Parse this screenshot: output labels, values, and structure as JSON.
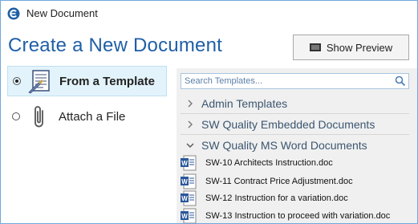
{
  "window": {
    "title": "New Document"
  },
  "header": {
    "title": "Create a New Document",
    "preview_button": "Show Preview"
  },
  "options": {
    "template": {
      "label": "From a Template",
      "selected": true
    },
    "attach": {
      "label": "Attach a File",
      "selected": false
    }
  },
  "search": {
    "placeholder": "Search Templates..."
  },
  "folders": [
    {
      "label": "Admin Templates",
      "expanded": false
    },
    {
      "label": "SW Quality Embedded Documents",
      "expanded": false
    },
    {
      "label": "SW Quality MS Word Documents",
      "expanded": true
    }
  ],
  "documents": [
    {
      "label": "SW-10 Architects Instruction.doc",
      "icon": "word-doc-icon"
    },
    {
      "label": "SW-11 Contract Price Adjustment.doc",
      "icon": "word-doc-icon"
    },
    {
      "label": "SW-12 Instruction for a variation.doc",
      "icon": "word-doc-icon"
    },
    {
      "label": "SW-13 Instruction to proceed with variation.doc",
      "icon": "word-doc-icon"
    }
  ],
  "colors": {
    "accent": "#1f5fa6",
    "selection": "#e3f3fb",
    "panel": "#f0f0f0",
    "word_blue": "#2b579a"
  }
}
